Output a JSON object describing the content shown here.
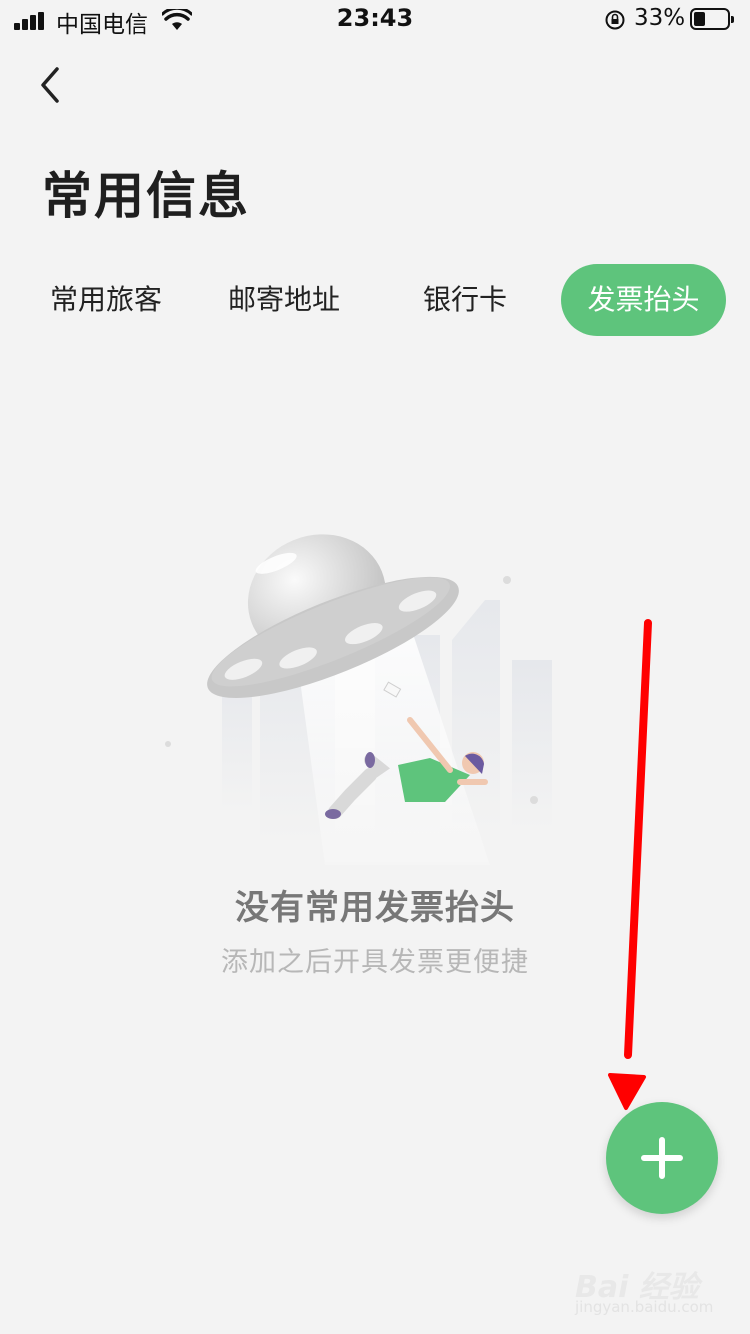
{
  "status_bar": {
    "carrier": "中国电信",
    "time": "23:43",
    "battery_percent": "33%",
    "battery_level": 0.33
  },
  "header": {
    "back_icon": "chevron-left-icon",
    "title": "常用信息"
  },
  "tabs": [
    {
      "label": "常用旅客",
      "active": false
    },
    {
      "label": "邮寄地址",
      "active": false
    },
    {
      "label": "银行卡",
      "active": false
    },
    {
      "label": "发票抬头",
      "active": true
    }
  ],
  "empty_state": {
    "title": "没有常用发票抬头",
    "subtitle": "添加之后开具发票更便捷"
  },
  "fab": {
    "icon": "plus-icon"
  },
  "watermark": {
    "brand": "Bai 经验",
    "url": "jingyan.baidu.com"
  },
  "colors": {
    "accent": "#5ec47c",
    "arrow": "#ff0000",
    "background": "#f3f3f3"
  }
}
